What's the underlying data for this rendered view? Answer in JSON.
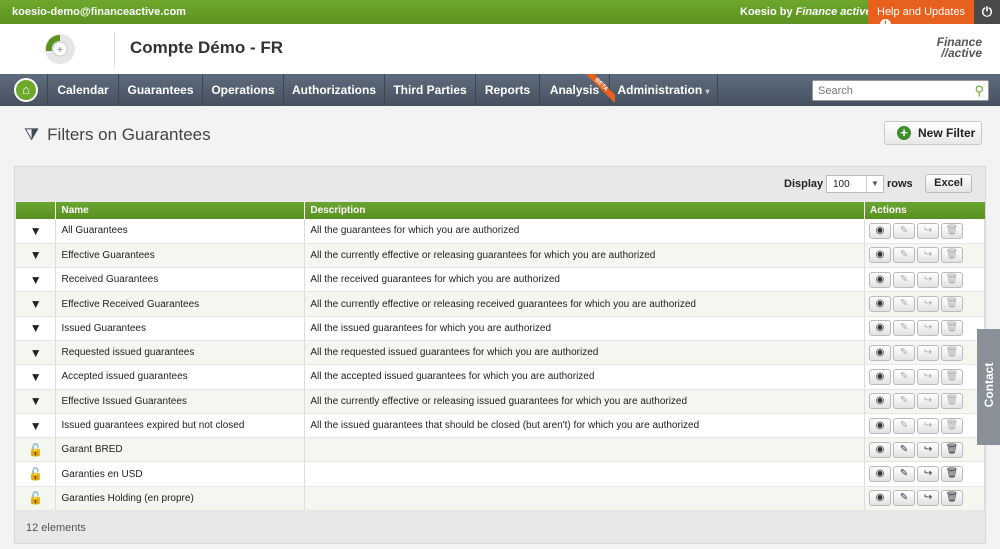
{
  "topbar": {
    "email": "koesio-demo@financeactive.com",
    "brand_name": "Koesio",
    "brand_by": "by",
    "brand_company": "Finance active",
    "help_label": "Help and Updates",
    "help_icon": "!",
    "power_icon": "power-icon"
  },
  "header": {
    "account": "Compte Démo - FR",
    "logo_line1": "Finance",
    "logo_line2": "//active"
  },
  "nav": {
    "items": [
      "Calendar",
      "Guarantees",
      "Operations",
      "Authorizations",
      "Third Parties",
      "Reports",
      "Analysis",
      "Administration"
    ],
    "beta": "BETA",
    "admin_caret": "▾"
  },
  "search": {
    "placeholder": "Search"
  },
  "page": {
    "title": "Filters on Guarantees",
    "new_filter": "New Filter"
  },
  "toolbar": {
    "display": "Display",
    "rows_value": "100",
    "rows_label": "rows",
    "excel": "Excel"
  },
  "table": {
    "headers": [
      "",
      "Name",
      "Description",
      "Actions"
    ],
    "rows": [
      {
        "icon": "filter",
        "name": "All Guarantees",
        "description": "All the guarantees for which you are authorized"
      },
      {
        "icon": "filter",
        "name": "Effective Guarantees",
        "description": "All the currently effective or releasing guarantees for which you are authorized"
      },
      {
        "icon": "filter",
        "name": "Received Guarantees",
        "description": "All the received guarantees for which you are authorized"
      },
      {
        "icon": "filter",
        "name": "Effective Received Guarantees",
        "description": "All the currently effective or releasing received guarantees for which you are authorized"
      },
      {
        "icon": "filter",
        "name": "Issued Guarantees",
        "description": "All the issued guarantees for which you are authorized"
      },
      {
        "icon": "filter",
        "name": "Requested issued guarantees",
        "description": "All the requested issued guarantees for which you are authorized"
      },
      {
        "icon": "filter",
        "name": "Accepted issued guarantees",
        "description": "All the accepted issued guarantees for which you are authorized"
      },
      {
        "icon": "filter",
        "name": "Effective Issued Guarantees",
        "description": "All the currently effective or releasing issued guarantees for which you are authorized"
      },
      {
        "icon": "filter",
        "name": "Issued guarantees expired but not closed",
        "description": "All the issued guarantees that should be closed (but aren't) for which you are authorized"
      },
      {
        "icon": "unlock",
        "name": "Garant BRED",
        "description": ""
      },
      {
        "icon": "unlock",
        "name": "Garanties en USD",
        "description": ""
      },
      {
        "icon": "unlock",
        "name": "Garanties Holding (en propre)",
        "description": ""
      }
    ]
  },
  "footer": {
    "count": "12 elements"
  },
  "contact": "Contact",
  "colors": {
    "green": "#6ea82c",
    "orange": "#e8601d",
    "nav": "#4e5a68"
  }
}
